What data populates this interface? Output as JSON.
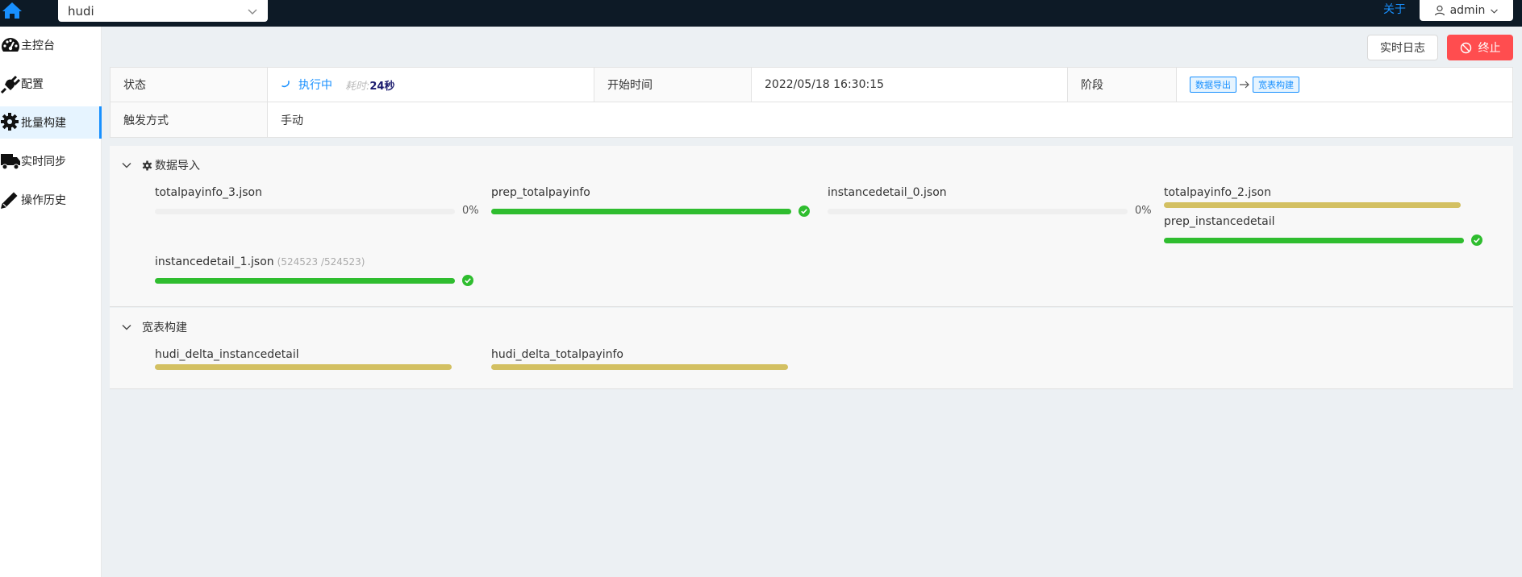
{
  "header": {
    "db_selected": "hudi",
    "about": "关于",
    "user": "admin"
  },
  "sidebar": {
    "items": [
      {
        "label": "主控台",
        "icon": "dashboard-icon"
      },
      {
        "label": "配置",
        "icon": "plug-icon"
      },
      {
        "label": "批量构建",
        "icon": "gear-icon",
        "active": true
      },
      {
        "label": "实时同步",
        "icon": "truck-icon"
      },
      {
        "label": "操作历史",
        "icon": "pencil-icon"
      }
    ]
  },
  "actions": {
    "log_label": "实时日志",
    "stop_label": "终止"
  },
  "info": {
    "status_label": "状态",
    "status_value": "执行中",
    "elapsed_label": "耗时:",
    "elapsed_value": "24秒",
    "start_label": "开始时间",
    "start_value": "2022/05/18 16:30:15",
    "stage_label": "阶段",
    "stages": [
      "数据导出",
      "宽表构建"
    ],
    "trigger_label": "触发方式",
    "trigger_value": "手动"
  },
  "panels": {
    "import": {
      "title": "数据导入",
      "tasks": [
        {
          "name": "totalpayinfo_3.json",
          "progress": 0,
          "pct_text": "0%",
          "state": "pending"
        },
        {
          "name": "prep_totalpayinfo",
          "progress": 100,
          "state": "done"
        },
        {
          "name": "instancedetail_0.json",
          "progress": 0,
          "pct_text": "0%",
          "state": "pending"
        },
        {
          "name": "totalpayinfo_2.json",
          "progress": 100,
          "state": "running"
        },
        {
          "name": "prep_instancedetail",
          "progress": 100,
          "state": "done"
        },
        {
          "name": "instancedetail_1.json",
          "count": "(524523 /524523)",
          "progress": 100,
          "state": "done"
        }
      ]
    },
    "build": {
      "title": "宽表构建",
      "tasks": [
        {
          "name": "hudi_delta_instancedetail",
          "progress": 100,
          "state": "running"
        },
        {
          "name": "hudi_delta_totalpayinfo",
          "progress": 100,
          "state": "running"
        }
      ]
    }
  },
  "colors": {
    "accent": "#1890ff",
    "success": "#2fbd2f",
    "running": "#d3c062",
    "danger": "#ff4d4f",
    "topbar": "#0d1a26"
  }
}
